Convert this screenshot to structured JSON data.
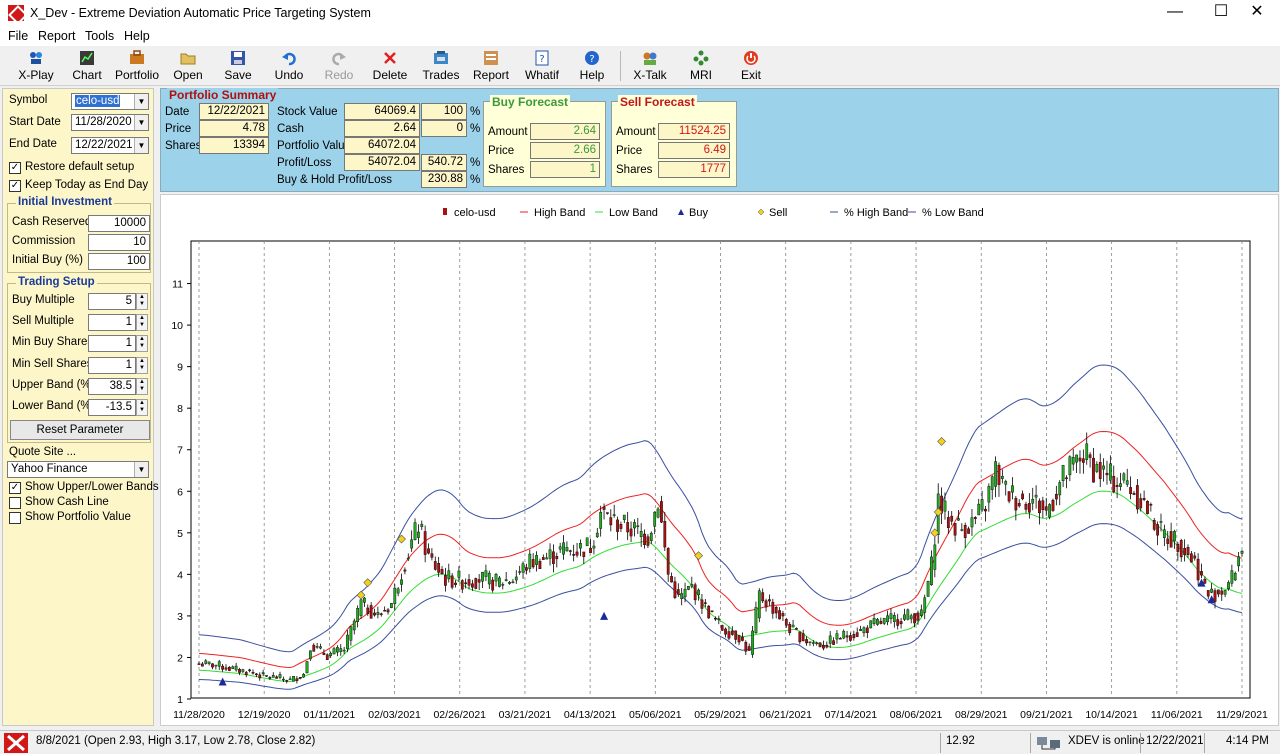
{
  "window": {
    "title": "X_Dev - Extreme Deviation Automatic Price Targeting System"
  },
  "menu": [
    "File",
    "Report",
    "Tools",
    "Help"
  ],
  "toolbar": [
    {
      "label": "X-Play",
      "icon": "xplay-icon"
    },
    {
      "label": "Chart",
      "icon": "chart-icon"
    },
    {
      "label": "Portfolio",
      "icon": "portfolio-icon"
    },
    {
      "label": "Open",
      "icon": "open-folder-icon"
    },
    {
      "label": "Save",
      "icon": "save-icon"
    },
    {
      "label": "Undo",
      "icon": "undo-icon"
    },
    {
      "label": "Redo",
      "icon": "redo-icon",
      "disabled": true
    },
    {
      "label": "Delete",
      "icon": "delete-icon"
    },
    {
      "label": "Trades",
      "icon": "trades-icon"
    },
    {
      "label": "Report",
      "icon": "report-icon"
    },
    {
      "label": "Whatif",
      "icon": "whatif-icon"
    },
    {
      "label": "Help",
      "icon": "help-icon"
    },
    {
      "label": "X-Talk",
      "icon": "xtalk-icon"
    },
    {
      "label": "MRI",
      "icon": "mri-icon"
    },
    {
      "label": "Exit",
      "icon": "exit-icon"
    }
  ],
  "left": {
    "symbol_label": "Symbol",
    "symbol": "celo-usd",
    "start_label": "Start Date",
    "start": "11/28/2020",
    "end_label": "End Date",
    "end": "12/22/2021",
    "restore": "Restore default setup",
    "keep_today": "Keep Today as End Day",
    "initial": {
      "title": "Initial Investment",
      "cash_label": "Cash Reserved",
      "cash": "10000",
      "commission_label": "Commission",
      "commission": "10",
      "initbuy_label": "Initial Buy (%)",
      "initbuy": "100"
    },
    "trading": {
      "title": "Trading Setup",
      "buy_mult_label": "Buy Multiple",
      "buy_mult": "5",
      "sell_mult_label": "Sell Multiple",
      "sell_mult": "1",
      "min_buy_label": "Min Buy Shares",
      "min_buy": "1",
      "min_sell_label": "Min Sell Shares",
      "min_sell": "1",
      "upper_label": "Upper Band (%)",
      "upper": "38.5",
      "lower_label": "Lower Band (%)",
      "lower": "-13.5",
      "reset": "Reset Parameter"
    },
    "quote_site_label": "Quote Site ...",
    "quote_site": "Yahoo Finance",
    "show_bands": "Show Upper/Lower Bands",
    "show_cash": "Show Cash Line",
    "show_portfolio": "Show Portfolio Value"
  },
  "summary": {
    "title": "Portfolio Summary",
    "date_label": "Date",
    "date": "12/22/2021",
    "price_label": "Price",
    "price": "4.78",
    "shares_label": "Shares",
    "shares": "13394",
    "stock_label": "Stock Value",
    "stock": "64069.4",
    "stock_pct": "100",
    "cash_label": "Cash",
    "cash": "2.64",
    "cash_pct": "0",
    "pv_label": "Portfolio Value",
    "pv": "64072.04",
    "pl_label": "Profit/Loss",
    "pl": "54072.04",
    "pl_pct": "540.72",
    "bh_label": "Buy & Hold Profit/Loss",
    "bh_pct": "230.88",
    "pct": "%",
    "buy": {
      "title": "Buy Forecast",
      "amount_label": "Amount",
      "amount": "2.64",
      "price_label": "Price",
      "price": "2.66",
      "shares_label": "Shares",
      "shares": "1"
    },
    "sell": {
      "title": "Sell Forecast",
      "amount_label": "Amount",
      "amount": "11524.25",
      "price_label": "Price",
      "price": "6.49",
      "shares_label": "Shares",
      "shares": "1777"
    }
  },
  "status": {
    "info": "8/8/2021 (Open 2.93, High 3.17, Low 2.78, Close 2.82)",
    "value": "12.92",
    "online": "XDEV is online",
    "date": "12/22/2021",
    "time": "4:14 PM"
  },
  "colors": {
    "candle_up": "#22aa22",
    "candle_down": "#aa1111",
    "high_band": "#ee2222",
    "low_band": "#33dd33",
    "pct_band": "#3a4fa0",
    "buy": "#1a2a9a",
    "sell": "#f0d020"
  },
  "chart_data": {
    "type": "candlestick",
    "legend": [
      "celo-usd",
      "High Band",
      "Low Band",
      "Buy",
      "Sell",
      "% High Band",
      "% Low Band"
    ],
    "ylim": [
      1,
      12
    ],
    "yticks": [
      1,
      2,
      3,
      4,
      5,
      6,
      7,
      8,
      9,
      10,
      11
    ],
    "xticks": [
      "11/28/2020",
      "12/19/2020",
      "01/11/2021",
      "02/03/2021",
      "02/26/2021",
      "03/21/2021",
      "04/13/2021",
      "05/06/2021",
      "05/29/2021",
      "06/21/2021",
      "07/14/2021",
      "08/06/2021",
      "08/29/2021",
      "09/21/2021",
      "10/14/2021",
      "11/06/2021",
      "11/29/2021"
    ],
    "close_anchors": [
      [
        0,
        1.85
      ],
      [
        5,
        1.82
      ],
      [
        10,
        1.72
      ],
      [
        15,
        1.65
      ],
      [
        19,
        1.55
      ],
      [
        23,
        1.52
      ],
      [
        27,
        1.45
      ],
      [
        31,
        1.6
      ],
      [
        33,
        2.3
      ],
      [
        38,
        2.05
      ],
      [
        43,
        2.2
      ],
      [
        48,
        3.3
      ],
      [
        53,
        3.0
      ],
      [
        57,
        3.3
      ],
      [
        60,
        4.1
      ],
      [
        65,
        5.2
      ],
      [
        68,
        4.4
      ],
      [
        73,
        3.9
      ],
      [
        78,
        3.85
      ],
      [
        83,
        3.9
      ],
      [
        88,
        3.8
      ],
      [
        93,
        3.9
      ],
      [
        98,
        4.3
      ],
      [
        103,
        4.4
      ],
      [
        108,
        4.6
      ],
      [
        112,
        4.6
      ],
      [
        116,
        4.7
      ],
      [
        119,
        5.5
      ],
      [
        122,
        5.3
      ],
      [
        128,
        5.1
      ],
      [
        133,
        4.9
      ],
      [
        136,
        5.8
      ],
      [
        139,
        4.0
      ],
      [
        142,
        3.4
      ],
      [
        146,
        3.7
      ],
      [
        150,
        3.2
      ],
      [
        155,
        2.7
      ],
      [
        160,
        2.5
      ],
      [
        163,
        2.1
      ],
      [
        166,
        3.5
      ],
      [
        170,
        3.2
      ],
      [
        175,
        2.7
      ],
      [
        180,
        2.4
      ],
      [
        185,
        2.3
      ],
      [
        190,
        2.5
      ],
      [
        195,
        2.6
      ],
      [
        200,
        2.8
      ],
      [
        205,
        2.9
      ],
      [
        210,
        3.0
      ],
      [
        214,
        3.0
      ],
      [
        217,
        4.2
      ],
      [
        219,
        5.8
      ],
      [
        222,
        5.3
      ],
      [
        226,
        5.1
      ],
      [
        230,
        5.3
      ],
      [
        233,
        5.7
      ],
      [
        236,
        6.5
      ],
      [
        239,
        6.0
      ],
      [
        243,
        5.8
      ],
      [
        247,
        5.8
      ],
      [
        251,
        5.5
      ],
      [
        255,
        6.2
      ],
      [
        259,
        6.6
      ],
      [
        262,
        6.9
      ],
      [
        265,
        6.6
      ],
      [
        270,
        6.3
      ],
      [
        275,
        6.2
      ],
      [
        280,
        5.7
      ],
      [
        285,
        5.0
      ],
      [
        290,
        4.8
      ],
      [
        295,
        4.3
      ],
      [
        299,
        3.5
      ],
      [
        303,
        3.6
      ],
      [
        306,
        3.9
      ],
      [
        309,
        4.7
      ]
    ],
    "buys": [
      [
        7,
        1.42
      ],
      [
        120,
        3.0
      ],
      [
        297,
        3.8
      ],
      [
        300,
        3.4
      ]
    ],
    "sells": [
      [
        48,
        3.5
      ],
      [
        50,
        3.8
      ],
      [
        60,
        4.85
      ],
      [
        148,
        4.45
      ],
      [
        218,
        5.0
      ],
      [
        219,
        5.5
      ],
      [
        220,
        7.2
      ]
    ]
  }
}
